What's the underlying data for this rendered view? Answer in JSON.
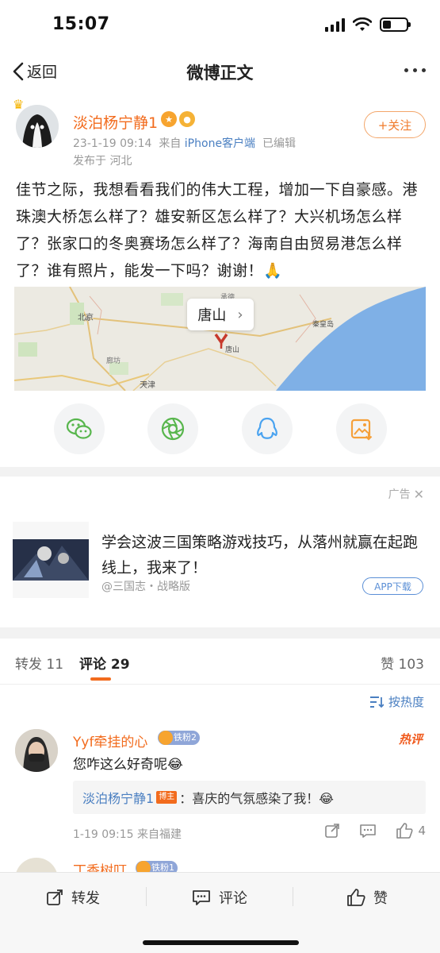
{
  "status_bar": {
    "time": "15:07",
    "battery_percent": 35
  },
  "nav": {
    "back_label": "返回",
    "title": "微博正文"
  },
  "post": {
    "author": "淡泊杨宁静1",
    "date": "23-1-19 09:14",
    "source_prefix": "来自",
    "client": "iPhone客户端",
    "edited": "已编辑",
    "location": "发布于 河北",
    "follow_label": "+关注",
    "text": "佳节之际，我想看看我们的伟大工程，增加一下自豪感。港珠澳大桥怎么样了？雄安新区怎么样了？大兴机场怎么样了？张家口的冬奥赛场怎么样了？海南自由贸易港怎么样了？谁有照片，能发一下吗？谢谢！🙏",
    "map": {
      "location_label": "唐山",
      "places": [
        "北京",
        "廊坊",
        "天津",
        "唐山",
        "秦皇岛",
        "承德"
      ]
    }
  },
  "share": {
    "icons": [
      "wechat-icon",
      "moments-icon",
      "qq-icon",
      "save-image-icon"
    ]
  },
  "ad": {
    "tag": "广告",
    "text": "学会这波三国策略游戏技巧，从落州就赢在起跑线上，我来了！",
    "source": "@三国志・战略版",
    "download_label": "APP下载"
  },
  "tabs": {
    "repost": "转发 11",
    "comments": "评论 29",
    "likes": "赞 103"
  },
  "sort_label": "按热度",
  "comments": [
    {
      "name": "Yyf牵挂的心",
      "badge": "铁粉2",
      "hot": "热评",
      "text": "您咋这么好奇呢😂",
      "reply_author": "淡泊杨宁静1",
      "reply_badge": "博主",
      "reply_text": "：喜庆的气氛感染了我！😂",
      "meta": "1-19 09:15  来自福建",
      "likes": "4"
    },
    {
      "name": "丁香树叮",
      "badge": "铁粉1"
    }
  ],
  "bottom_bar": {
    "repost": "转发",
    "comment": "评论",
    "like": "赞"
  },
  "colors": {
    "accent": "#f26b1d",
    "link": "#4a7fc1",
    "separator": "#f2f2f2"
  }
}
